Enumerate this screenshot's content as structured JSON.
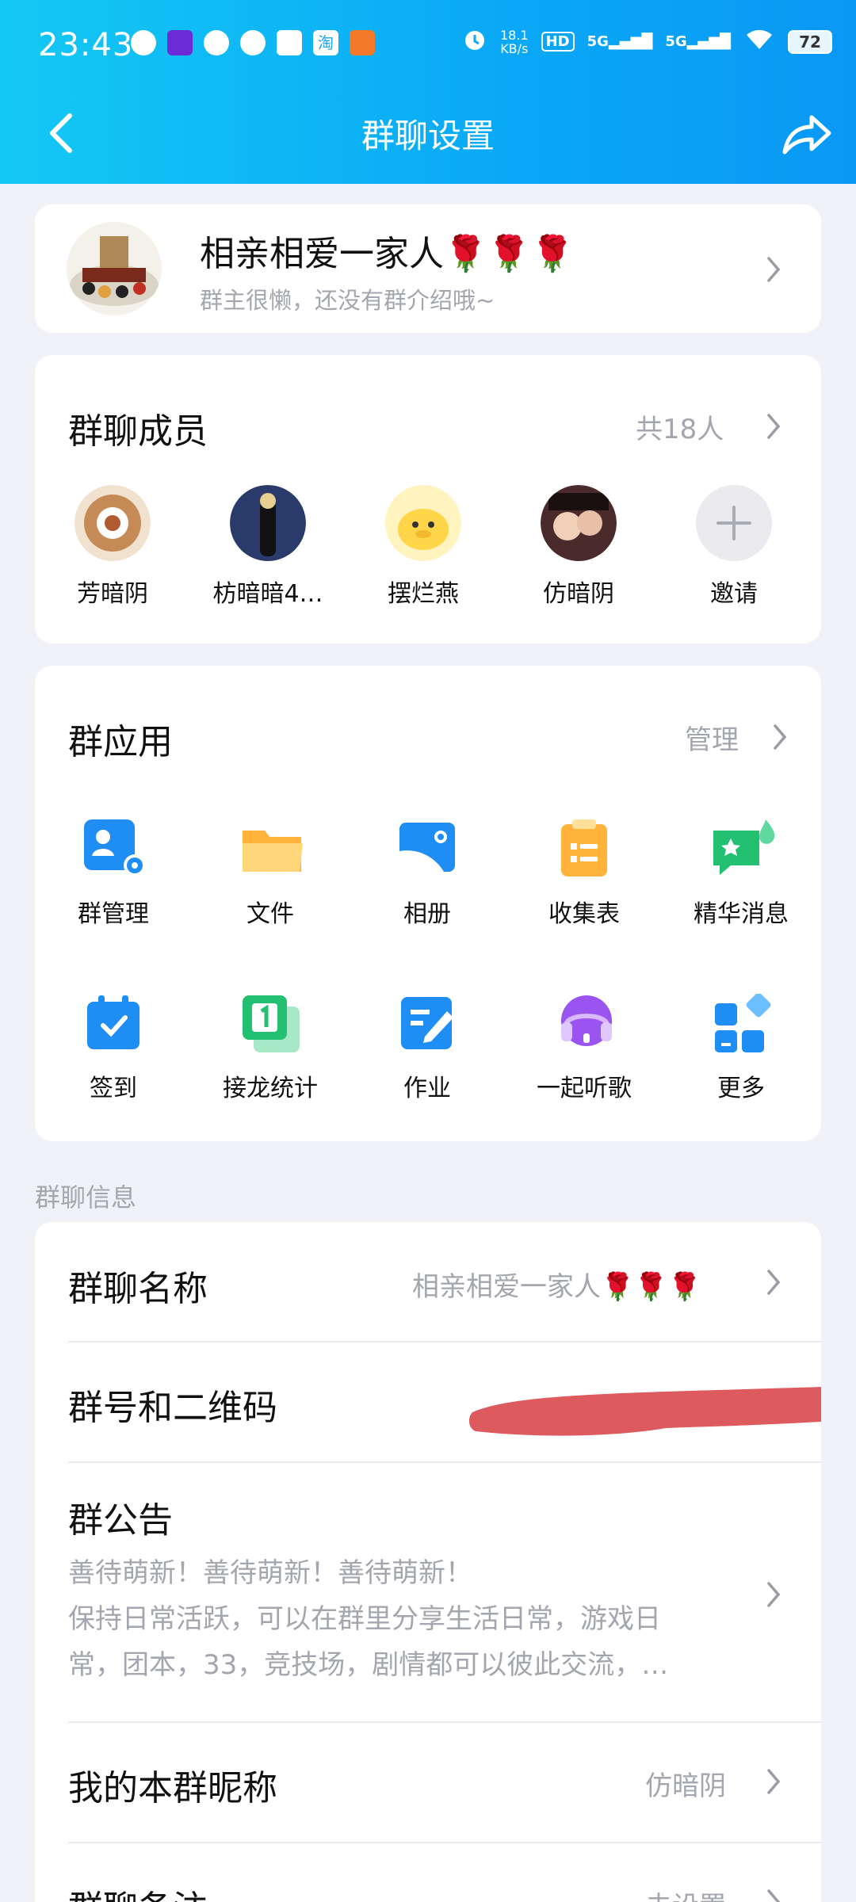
{
  "status_bar": {
    "time": "23:43",
    "net_speed_value": "18.1",
    "net_speed_unit": "KB/s",
    "hd_label": "HD",
    "signal_1": "5G",
    "signal_2": "5G",
    "battery": "72",
    "taobao_glyph": "淘"
  },
  "nav": {
    "title": "群聊设置",
    "back_icon": "back-arrow-icon",
    "share_icon": "share-icon"
  },
  "group": {
    "name": "相亲相爱一家人🌹🌹🌹",
    "description": "群主很懒，还没有群介绍哦~"
  },
  "members": {
    "title": "群聊成员",
    "count_text": "共18人",
    "items": [
      {
        "name": "芳暗阴"
      },
      {
        "name": "枋暗暗4…"
      },
      {
        "name": "摆烂燕"
      },
      {
        "name": "仿暗阴"
      },
      {
        "name": "邀请"
      }
    ]
  },
  "apps": {
    "title": "群应用",
    "manage_label": "管理",
    "items": [
      {
        "label": "群管理",
        "icon": "group-manage-icon",
        "color": "#1e8ef5"
      },
      {
        "label": "文件",
        "icon": "folder-icon",
        "color": "#ffb33a"
      },
      {
        "label": "相册",
        "icon": "album-icon",
        "color": "#1e8ef5"
      },
      {
        "label": "收集表",
        "icon": "clipboard-icon",
        "color": "#ffb33a"
      },
      {
        "label": "精华消息",
        "icon": "essence-message-icon",
        "color": "#22c070"
      },
      {
        "label": "签到",
        "icon": "calendar-check-icon",
        "color": "#1e8ef5"
      },
      {
        "label": "接龙统计",
        "icon": "relay-stats-icon",
        "color": "#22c070"
      },
      {
        "label": "作业",
        "icon": "homework-icon",
        "color": "#1e8ef5"
      },
      {
        "label": "一起听歌",
        "icon": "listen-together-icon",
        "color": "#9a55f0"
      },
      {
        "label": "更多",
        "icon": "more-grid-icon",
        "color": "#1e8ef5"
      }
    ]
  },
  "info": {
    "section_label": "群聊信息",
    "group_name_title": "群聊名称",
    "group_name_value": "相亲相爱一家人🌹🌹🌹",
    "qr_title": "群号和二维码",
    "notice_title": "群公告",
    "notice_line1": "善待萌新！善待萌新！善待萌新！",
    "notice_line2": "保持日常活跃，可以在群里分享生活日常，游戏日",
    "notice_line3": "常，团本，33，竞技场，剧情都可以彼此交流，…",
    "nickname_title": "我的本群昵称",
    "nickname_value": "仿暗阴",
    "remark_title": "群聊备注",
    "remark_value": "未设置"
  }
}
